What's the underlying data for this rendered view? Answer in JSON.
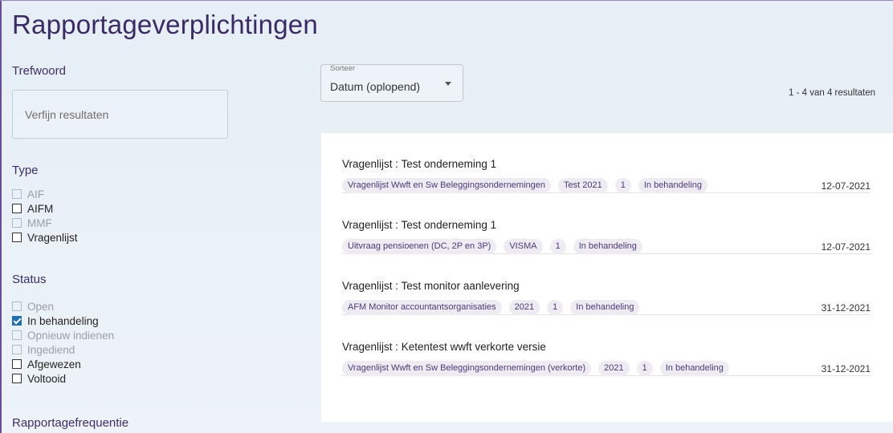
{
  "page": {
    "title": "Rapportageverplichtingen"
  },
  "sidebar": {
    "keyword": {
      "label": "Trefwoord",
      "placeholder": "Verfijn resultaten",
      "value": ""
    },
    "type": {
      "label": "Type",
      "options": [
        {
          "label": "AIF",
          "checked": false,
          "disabled": true
        },
        {
          "label": "AIFM",
          "checked": false,
          "disabled": false
        },
        {
          "label": "MMF",
          "checked": false,
          "disabled": true
        },
        {
          "label": "Vragenlijst",
          "checked": false,
          "disabled": false
        }
      ]
    },
    "status": {
      "label": "Status",
      "options": [
        {
          "label": "Open",
          "checked": false,
          "disabled": true
        },
        {
          "label": "In behandeling",
          "checked": true,
          "disabled": false
        },
        {
          "label": "Opnieuw indienen",
          "checked": false,
          "disabled": true
        },
        {
          "label": "Ingediend",
          "checked": false,
          "disabled": true
        },
        {
          "label": "Afgewezen",
          "checked": false,
          "disabled": false
        },
        {
          "label": "Voltooid",
          "checked": false,
          "disabled": false
        }
      ]
    },
    "frequency": {
      "label": "Rapportagefrequentie"
    }
  },
  "sort": {
    "legend": "Sorteer",
    "value": "Datum (oplopend)"
  },
  "results": {
    "count_text": "1 - 4 van 4 resultaten",
    "items": [
      {
        "title": "Vragenlijst : Test onderneming 1",
        "tags": [
          "Vragenlijst Wwft en Sw Beleggingsondernemingen",
          "Test 2021",
          "1",
          "In behandeling"
        ],
        "date": "12-07-2021"
      },
      {
        "title": "Vragenlijst : Test onderneming 1",
        "tags": [
          "Uitvraag pensioenen (DC, 2P en 3P)",
          "VISMA",
          "1",
          "In behandeling"
        ],
        "date": "12-07-2021"
      },
      {
        "title": "Vragenlijst : Test monitor aanlevering",
        "tags": [
          "AFM Monitor accountantsorganisaties",
          "2021",
          "1",
          "In behandeling"
        ],
        "date": "31-12-2021"
      },
      {
        "title": "Vragenlijst : Ketentest wwft verkorte versie",
        "tags": [
          "Vragenlijst Wwft en Sw Beleggingsondernemingen (verkorte)",
          "2021",
          "1",
          "In behandeling"
        ],
        "date": "31-12-2021"
      }
    ]
  }
}
